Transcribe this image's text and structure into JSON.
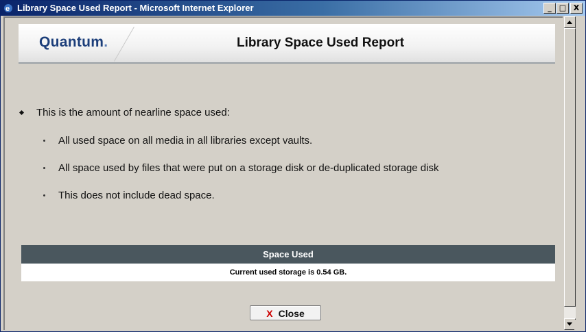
{
  "window": {
    "title": "Library Space Used Report - Microsoft Internet Explorer",
    "minimize_glyph": "_",
    "maximize_glyph": "□",
    "close_glyph": "X"
  },
  "header": {
    "brand": "Quantum",
    "brand_dot": ".",
    "title": "Library Space Used Report"
  },
  "description": {
    "intro": "This is the amount of nearline space used:",
    "items": [
      "All used space on all media in all libraries except vaults.",
      "All space used by files that were put on a storage disk or de-duplicated storage disk",
      "This does not include dead space."
    ]
  },
  "space_table": {
    "header": "Space Used",
    "value": "Current used storage is 0.54 GB."
  },
  "close_button": {
    "icon": "X",
    "label": "Close"
  },
  "colors": {
    "titlebar_start": "#0a246a",
    "brand": "#1c3e7a",
    "table_header": "#4a575e",
    "close_icon": "#cc0000"
  },
  "icons": [
    "ie-icon",
    "minimize-icon",
    "maximize-icon",
    "close-icon",
    "scroll-up-icon",
    "scroll-down-icon",
    "close-x-icon"
  ]
}
